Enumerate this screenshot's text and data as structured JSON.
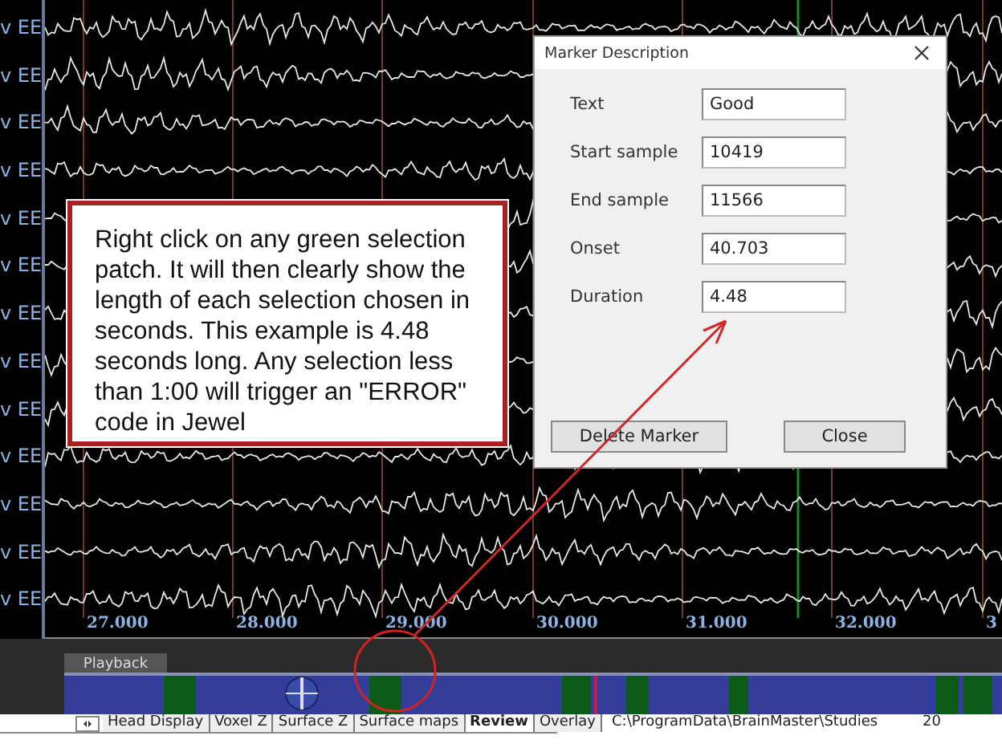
{
  "channels": [
    {
      "label": "v EE"
    },
    {
      "label": "v EE"
    },
    {
      "label": "v EE"
    },
    {
      "label": "v EE"
    },
    {
      "label": "v EE"
    },
    {
      "label": "v EE"
    },
    {
      "label": "v EE"
    },
    {
      "label": "v EE"
    },
    {
      "label": "v EE"
    },
    {
      "label": "v EE"
    },
    {
      "label": "v EE"
    },
    {
      "label": "v EE"
    },
    {
      "label": "v EE"
    }
  ],
  "time_axis": [
    "27.000",
    "28.000",
    "29.000",
    "30.000",
    "31.000",
    "32.000",
    "3"
  ],
  "timeline": {
    "playback_tab": "Playback"
  },
  "tabs": [
    {
      "label": "Head Display",
      "selected": false
    },
    {
      "label": "Voxel Z",
      "selected": false
    },
    {
      "label": "Surface Z",
      "selected": false
    },
    {
      "label": "Surface maps",
      "selected": false
    },
    {
      "label": "Review",
      "selected": true
    },
    {
      "label": "Overlay",
      "selected": false
    }
  ],
  "status_bar": {
    "path": "C:\\ProgramData\\BrainMaster\\Studies",
    "count": "20"
  },
  "dialog": {
    "title": "Marker Description",
    "fields": [
      {
        "label": "Text",
        "value": "Good"
      },
      {
        "label": "Start sample",
        "value": "10419"
      },
      {
        "label": "End sample",
        "value": "11566"
      },
      {
        "label": "Onset",
        "value": "40.703"
      },
      {
        "label": "Duration",
        "value": "4.48"
      }
    ],
    "buttons": [
      "Delete Marker",
      "Close"
    ]
  },
  "callout": {
    "text": "Right click on any green selection patch. It will then clearly show the length of each selection chosen in seconds. This example is 4.48 seconds long. Any selection less than 1:00 will trigger an \"ERROR\" code in Jewel"
  }
}
